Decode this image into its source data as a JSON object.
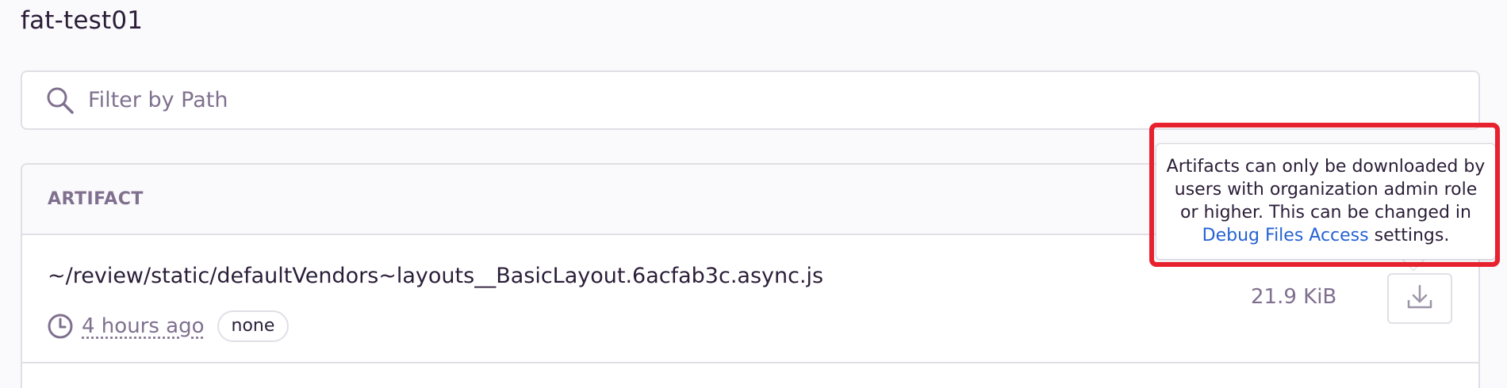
{
  "page": {
    "title": "fat-test01"
  },
  "search": {
    "placeholder": "Filter by Path",
    "icon": "search-icon"
  },
  "table": {
    "header": {
      "artifact": "ARTIFACT"
    },
    "rows": [
      {
        "path": "~/review/static/defaultVendors~layouts__BasicLayout.6acfab3c.async.js",
        "time_ago": "4 hours ago",
        "tag": "none",
        "size": "21.9 KiB",
        "download_icon": "download-icon"
      }
    ]
  },
  "tooltip": {
    "text_before": "Artifacts can only be downloaded by users with organization admin role or higher. This can be changed in ",
    "link": "Debug Files Access",
    "text_after": " settings."
  },
  "colors": {
    "text": "#2b1d38",
    "muted": "#80708f",
    "border": "#e2dee6",
    "link": "#2562d4",
    "highlight": "#e8212e"
  }
}
